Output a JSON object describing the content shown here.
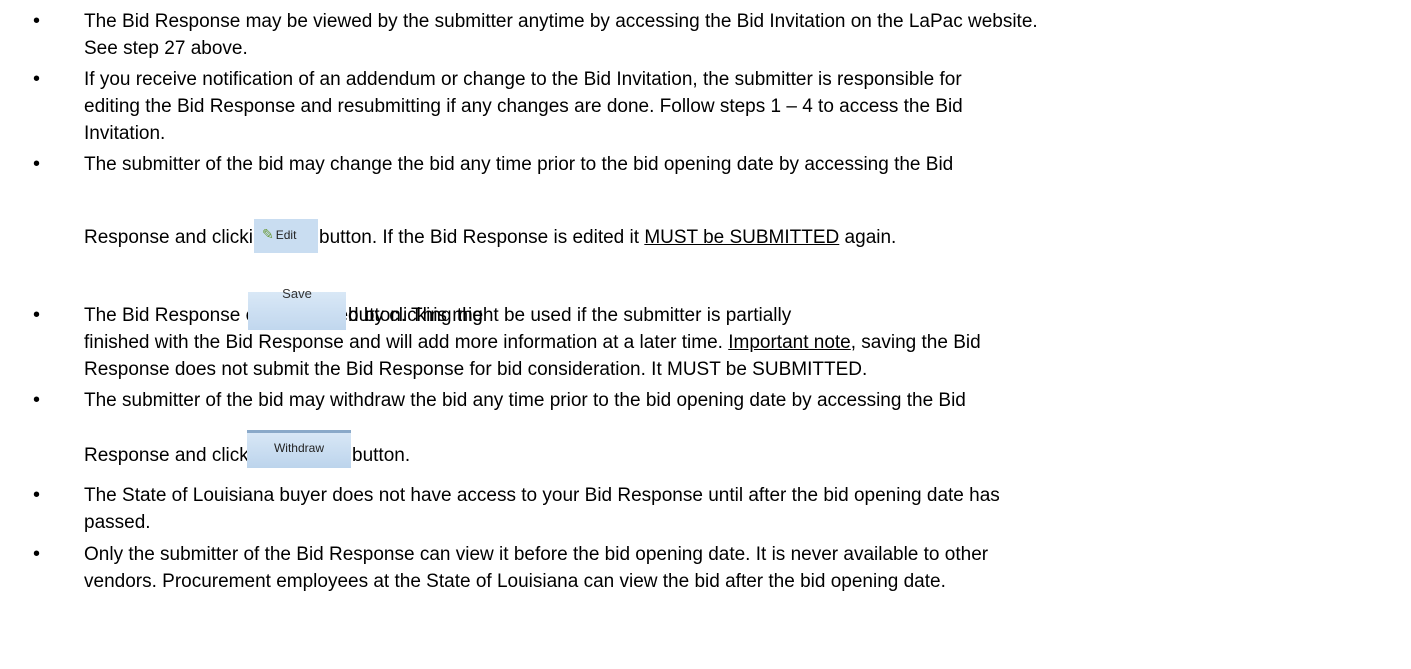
{
  "bullets": [
    {
      "lines": [
        "The Bid Response may be viewed by the submitter anytime by accessing the Bid Invitation on the LaPac website.",
        "See step 27 above."
      ]
    },
    {
      "lines": [
        "If you receive notification of an addendum or change to the Bid Invitation, the submitter is responsible for",
        "editing the Bid Response and resubmitting if any changes are done.  Follow steps 1 – 4 to access the Bid",
        "Invitation."
      ]
    },
    {
      "line1": "The submitter of the bid may change the bid any time prior to the bid opening date by accessing the Bid",
      "line2_before": "Response and clicking the",
      "line2_middle": "button.  If the Bid Response is edited it ",
      "line2_underlined": "MUST be SUBMITTED",
      "line2_after": " again."
    },
    {
      "line1_before": "The Bid Response can be saved by clicking the",
      "line1_after": "button.  This might be used if the submitter is partially",
      "line2": "finished with the Bid Response and will add more information at a later time.  ",
      "line2_underlined": "Important note",
      "line2_after": ", saving the Bid",
      "line3": "Response does not submit the Bid Response for bid consideration.  It MUST be SUBMITTED."
    },
    {
      "line1": "The submitter of the bid may withdraw the bid any time prior to the bid opening date by accessing the Bid",
      "line2_before": "Response and clicking the",
      "line2_after": "button."
    },
    {
      "lines": [
        "The State of Louisiana buyer does not have access to your Bid Response until after the bid opening date has",
        "passed."
      ]
    },
    {
      "lines": [
        "Only the submitter of the Bid Response can view it before the bid opening date.  It is never available to other",
        "vendors.  Procurement employees at the State of Louisiana can view the bid after the bid opening date."
      ]
    }
  ],
  "buttons": {
    "edit_label": "Edit",
    "save_label": "Save",
    "withdraw_label": "Withdraw"
  },
  "bullet_glyph": "•"
}
